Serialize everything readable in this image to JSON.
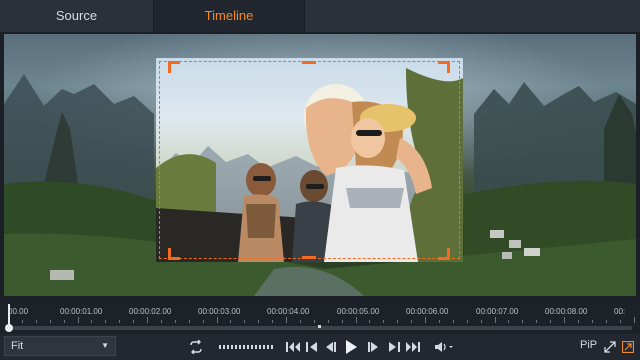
{
  "tabs": {
    "source": "Source",
    "timeline": "Timeline"
  },
  "timeline": {
    "marks": [
      "00.00",
      "00:00:01.00",
      "00:00:02.00",
      "00:00:03.00",
      "00:00:04.00",
      "00:00:05.00",
      "00:00:06.00",
      "00:00:07.00",
      "00:00:08.00",
      "00:"
    ]
  },
  "controls": {
    "fit_value": "Fit",
    "pip_label": "PiP"
  },
  "colors": {
    "accent": "#f36a21",
    "tab_active_text": "#f08a2a"
  },
  "icons": [
    "loop-icon",
    "jog-shuttle-icon",
    "go-to-start-icon",
    "previous-marker-icon",
    "step-back-icon",
    "play-icon",
    "step-forward-icon",
    "next-marker-icon",
    "go-to-end-icon",
    "volume-icon",
    "fullscreen-icon",
    "external-preview-icon"
  ]
}
